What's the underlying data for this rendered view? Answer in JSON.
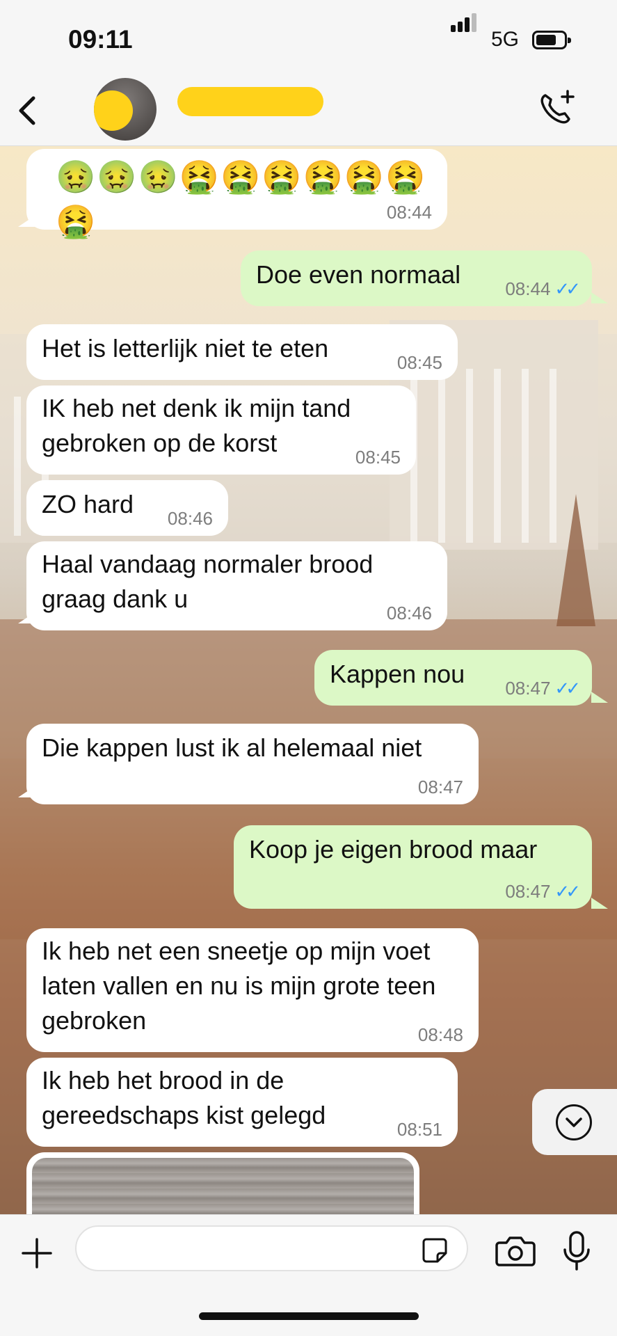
{
  "status_bar": {
    "time": "09:11",
    "network": "5G"
  },
  "header": {
    "contact_name": "",
    "back_icon": "chevron-left-icon",
    "call_icon": "add-call-icon"
  },
  "messages": [
    {
      "dir": "in",
      "text": "🤢🤢🤢🤮🤮🤮🤮🤮🤮🤮",
      "time": "08:44"
    },
    {
      "dir": "out",
      "text": "Doe even normaal",
      "time": "08:44",
      "read": true
    },
    {
      "dir": "in",
      "text": "Het is letterlijk niet te eten",
      "time": "08:45"
    },
    {
      "dir": "in",
      "line1": "IK heb net denk ik mijn tand",
      "line2": "gebroken op de korst",
      "time": "08:45"
    },
    {
      "dir": "in",
      "text": "ZO hard",
      "time": "08:46"
    },
    {
      "dir": "in",
      "line1": "Haal vandaag normaler brood",
      "line2": "graag dank u",
      "time": "08:46"
    },
    {
      "dir": "out",
      "text": "Kappen nou",
      "time": "08:47",
      "read": true
    },
    {
      "dir": "in",
      "text": "Die kappen lust ik al helemaal niet",
      "time": "08:47"
    },
    {
      "dir": "out",
      "text": "Koop je eigen brood maar",
      "time": "08:47",
      "read": true
    },
    {
      "dir": "in",
      "line1": "Ik heb net een sneetje op mijn voet",
      "line2": "laten vallen en nu is mijn grote teen",
      "line3": "gebroken",
      "time": "08:48"
    },
    {
      "dir": "in",
      "line1": "Ik heb het brood in de",
      "line2": "gereedschaps kist gelegd",
      "time": "08:51"
    }
  ],
  "read_ticks": "✓✓",
  "input": {
    "placeholder": "",
    "value": ""
  },
  "icons": {
    "plus": "plus-icon",
    "sticker": "sticker-icon",
    "camera": "camera-icon",
    "mic": "microphone-icon",
    "scroll_down": "chevron-down-circle-icon"
  }
}
